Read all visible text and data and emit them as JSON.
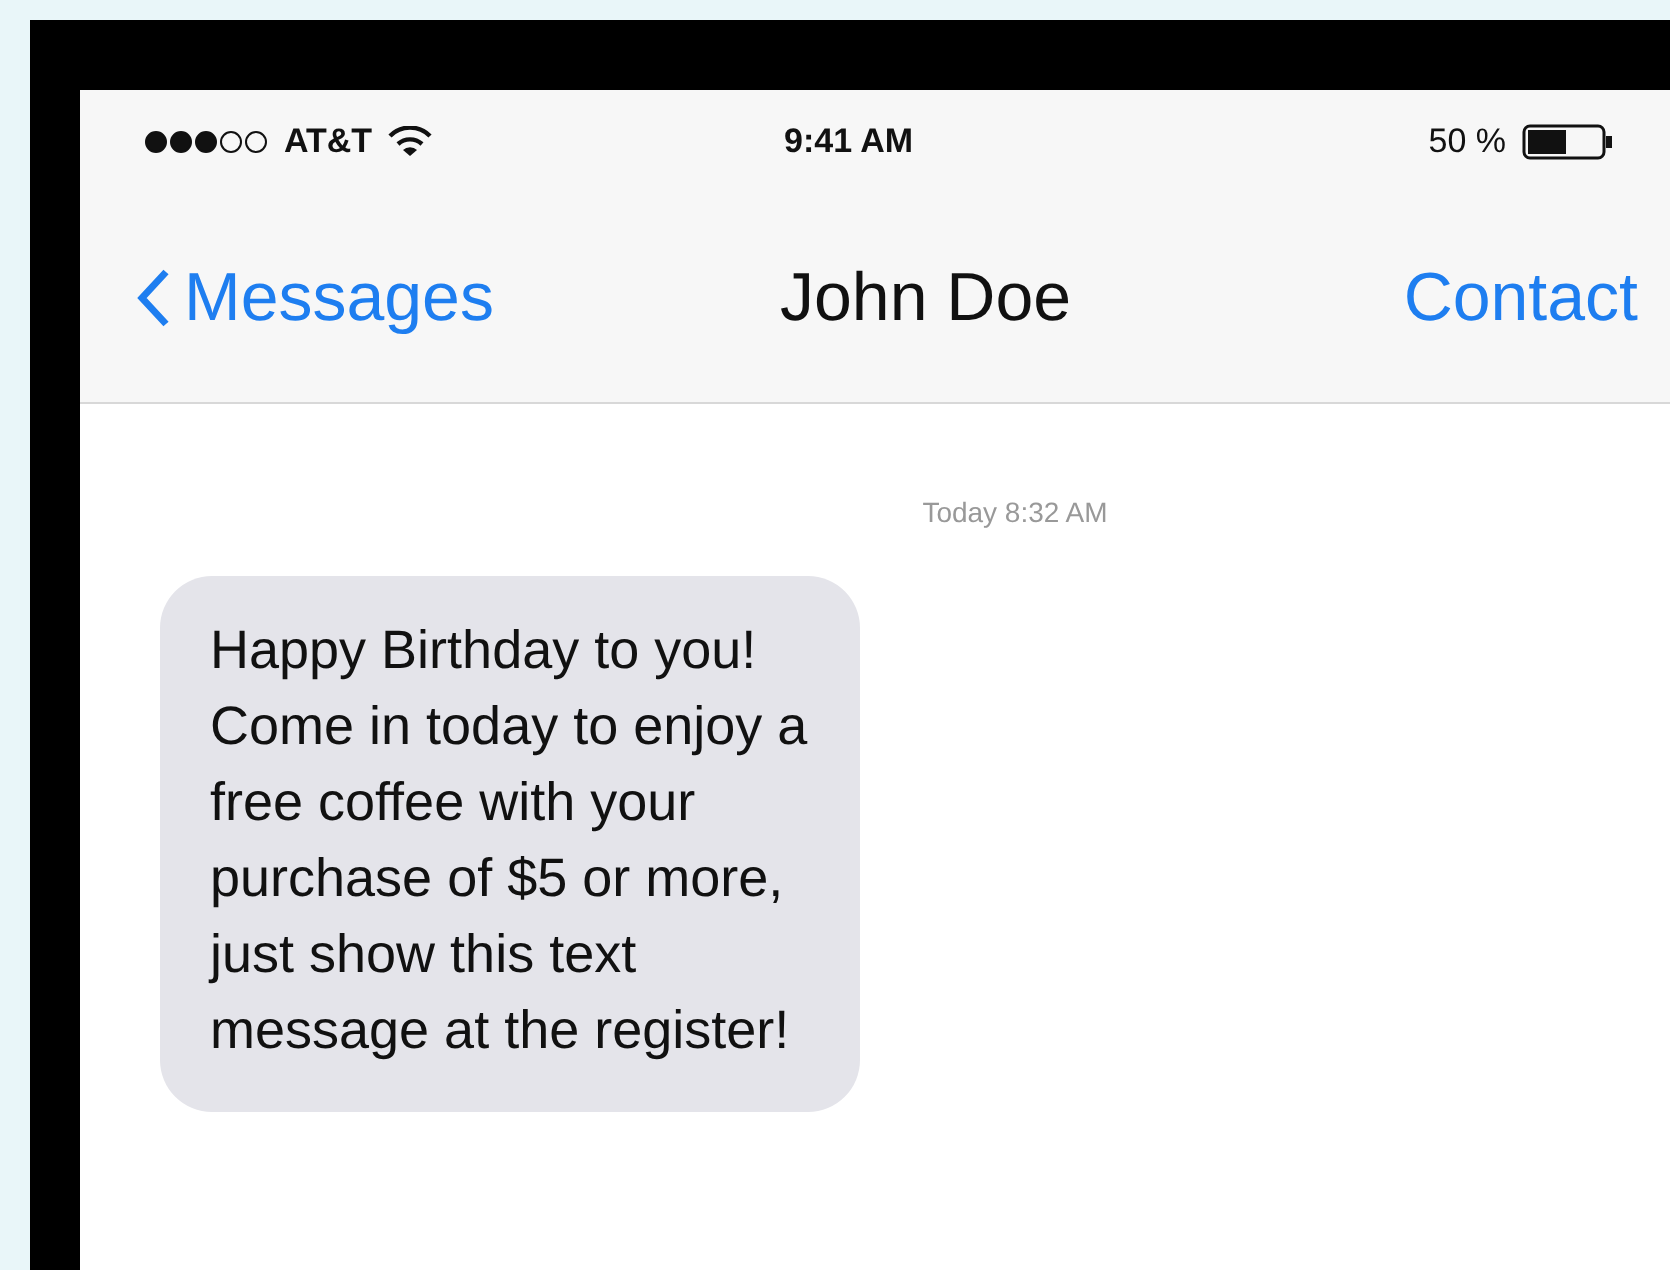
{
  "status_bar": {
    "carrier": "AT&T",
    "time": "9:41 AM",
    "battery": "50 %"
  },
  "nav_bar": {
    "back": "Messages",
    "title": "John Doe",
    "action": "Contact"
  },
  "conversation": {
    "timestamp": "Today 8:32 AM",
    "messages": [
      {
        "kind": "incoming",
        "text": "Happy Birthday to you!\nCome in today to enjoy a\nfree coffee with your\npurchase of $5 or more,\njust show this text\nmessage at the register!"
      }
    ]
  }
}
